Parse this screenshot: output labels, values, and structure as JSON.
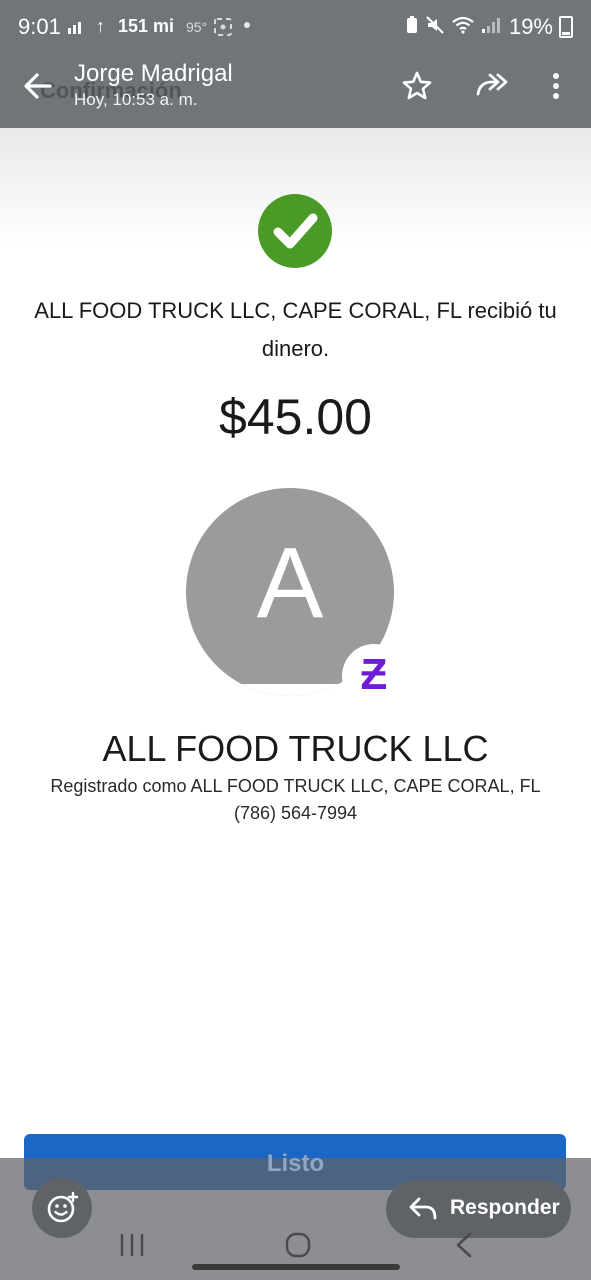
{
  "status_bar": {
    "time": "9:01",
    "distance": "151 mi",
    "temperature": "95°",
    "battery_percent": "19%"
  },
  "header": {
    "sender_name": "Jorge Madrigal",
    "timestamp": "Hoy, 10:53 a. m.",
    "underlying_title": "Confirmación",
    "icons": [
      "back-arrow-icon",
      "star-icon",
      "forward-all-icon",
      "more-vert-icon"
    ]
  },
  "receipt": {
    "message": "ALL FOOD TRUCK LLC, CAPE CORAL, FL recibió tu dinero.",
    "amount": "$45.00",
    "avatar_letter": "A",
    "badge_glyph": "Ƶ",
    "merchant_name": "ALL FOOD TRUCK LLC",
    "registered_as": "Registrado como ALL FOOD TRUCK LLC, CAPE CORAL, FL",
    "phone": "(786) 564-7994"
  },
  "actions": {
    "done_label": "Listo",
    "reply_label": "Responder"
  },
  "colors": {
    "success_green": "#4a9a27",
    "zelle_purple": "#6d1ed4",
    "button_blue": "#1b68c4",
    "overlay_gray": "#70757a"
  }
}
